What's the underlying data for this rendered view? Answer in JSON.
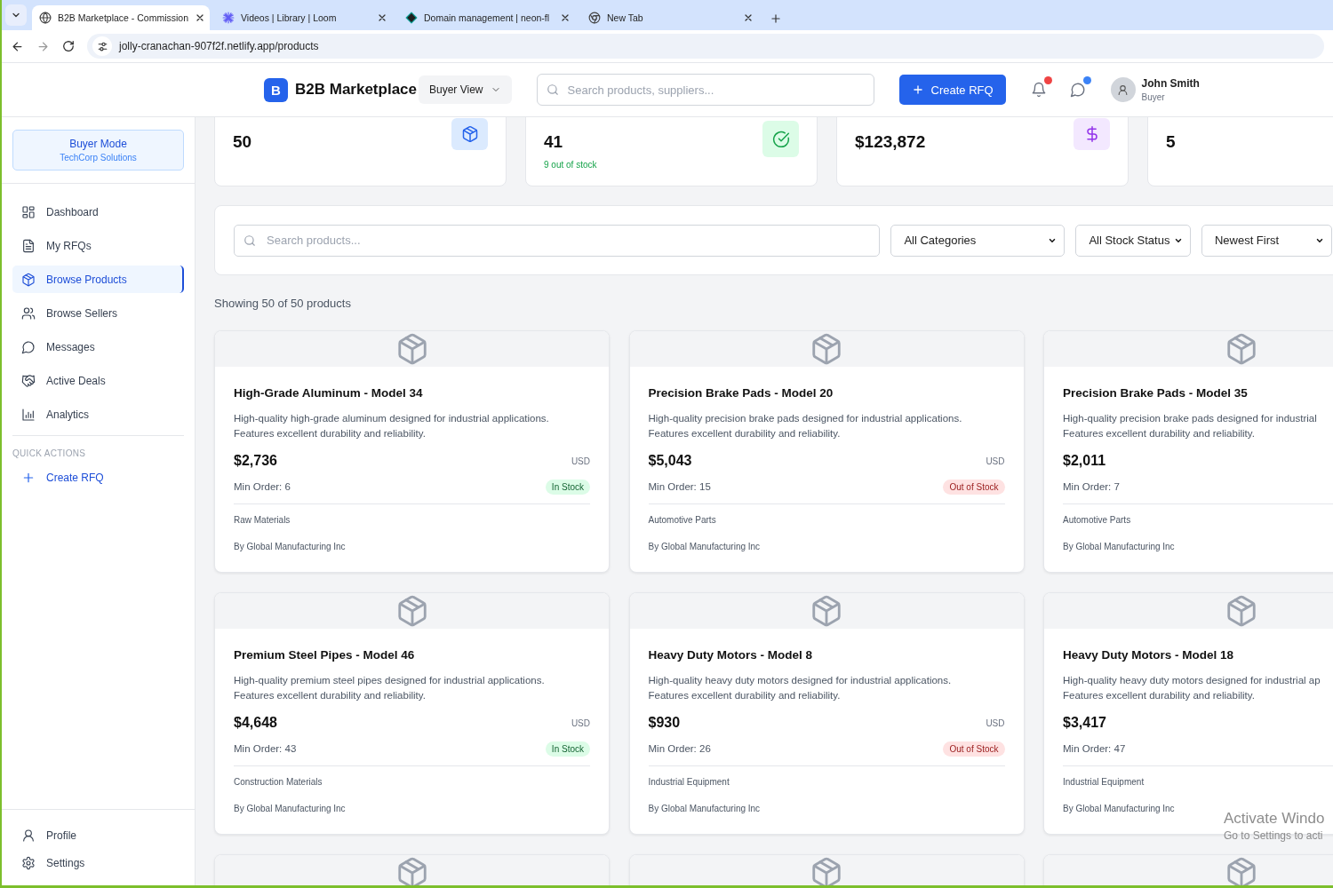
{
  "browser": {
    "tabs": [
      {
        "title": "B2B Marketplace - Commission",
        "kind": "globe",
        "selected": true
      },
      {
        "title": "Videos | Library | Loom",
        "kind": "burst",
        "selected": false
      },
      {
        "title": "Domain management | neon-fl",
        "kind": "diamond",
        "selected": false
      },
      {
        "title": "New Tab",
        "kind": "ring",
        "selected": false
      }
    ],
    "address": "jolly-cranachan-907f2f.netlify.app/products"
  },
  "header": {
    "logo_letter": "B",
    "brand": "B2B Marketplace",
    "view_select": "Buyer View",
    "search_placeholder": "Search products, suppliers...",
    "create_button": "Create RFQ",
    "notifications": [
      {
        "kind": "bell",
        "color": "#ef4444"
      },
      {
        "kind": "chat",
        "color": "#3b82f6"
      }
    ],
    "user": {
      "name": "John Smith",
      "role": "Buyer"
    }
  },
  "sidebar": {
    "mode_card": {
      "title": "Buyer Mode",
      "subtitle": "TechCorp Solutions"
    },
    "nav": [
      {
        "label": "Dashboard",
        "kind": "grid",
        "selected": false
      },
      {
        "label": "My RFQs",
        "kind": "file",
        "selected": false
      },
      {
        "label": "Browse Products",
        "kind": "box",
        "selected": true
      },
      {
        "label": "Browse Sellers",
        "kind": "users",
        "selected": false
      },
      {
        "label": "Messages",
        "kind": "chat",
        "selected": false
      },
      {
        "label": "Active Deals",
        "kind": "handshake",
        "selected": false
      },
      {
        "label": "Analytics",
        "kind": "chart",
        "selected": false
      }
    ],
    "quick_actions": {
      "heading": "QUICK ACTIONS",
      "items": [
        {
          "label": "Create RFQ",
          "kind": "plus"
        }
      ]
    },
    "footer_nav": [
      {
        "label": "Profile",
        "kind": "user"
      },
      {
        "label": "Settings",
        "kind": "gear"
      }
    ]
  },
  "stats": [
    {
      "value": "50",
      "kind": "box"
    },
    {
      "value": "41",
      "note": "9 out of stock",
      "kind": "check"
    },
    {
      "value": "$123,872",
      "kind": "dollar"
    },
    {
      "value": "5",
      "kind": "plain"
    }
  ],
  "filters": {
    "search_placeholder": "Search products...",
    "selects": [
      "All Categories",
      "All Stock Status",
      "Newest First"
    ]
  },
  "result_count": "Showing 50 of 50 products",
  "products": [
    {
      "kind": "full",
      "title": "High-Grade Aluminum - Model 34",
      "description": [
        "High-quality high-grade aluminum designed for industrial applications.",
        "Features excellent durability and reliability."
      ],
      "price": "$2,736",
      "currency": "USD",
      "min_order": "Min Order: 6",
      "stock": {
        "label": "In Stock",
        "in_stock": true
      },
      "category": "Raw Materials",
      "seller": "By Global Manufacturing Inc"
    },
    {
      "kind": "full",
      "title": "Precision Brake Pads - Model 20",
      "description": [
        "High-quality precision brake pads designed for industrial applications.",
        "Features excellent durability and reliability."
      ],
      "price": "$5,043",
      "currency": "USD",
      "min_order": "Min Order: 15",
      "stock": {
        "label": "Out of Stock",
        "in_stock": false
      },
      "category": "Automotive Parts",
      "seller": "By Global Manufacturing Inc"
    },
    {
      "kind": "full",
      "title": "Precision Brake Pads - Model 35",
      "description": [
        "High-quality precision brake pads designed for industrial",
        "Features excellent durability and reliability."
      ],
      "price": "$2,011",
      "min_order": "Min Order: 7",
      "category": "Automotive Parts",
      "seller": "By Global Manufacturing Inc"
    },
    {
      "kind": "full",
      "title": "Premium Steel Pipes - Model 46",
      "description": [
        "High-quality premium steel pipes designed for industrial applications.",
        "Features excellent durability and reliability."
      ],
      "price": "$4,648",
      "currency": "USD",
      "min_order": "Min Order: 43",
      "stock": {
        "label": "In Stock",
        "in_stock": true
      },
      "category": "Construction Materials",
      "seller": "By Global Manufacturing Inc"
    },
    {
      "kind": "full",
      "title": "Heavy Duty Motors - Model 8",
      "description": [
        "High-quality heavy duty motors designed for industrial applications.",
        "Features excellent durability and reliability."
      ],
      "price": "$930",
      "currency": "USD",
      "min_order": "Min Order: 26",
      "stock": {
        "label": "Out of Stock",
        "in_stock": false
      },
      "category": "Industrial Equipment",
      "seller": "By Global Manufacturing Inc"
    },
    {
      "kind": "full",
      "title": "Heavy Duty Motors - Model 18",
      "description": [
        "High-quality heavy duty motors designed for industrial ap",
        "Features excellent durability and reliability."
      ],
      "price": "$3,417",
      "min_order": "Min Order: 47",
      "category": "Industrial Equipment",
      "seller": "By Global Manufacturing Inc"
    },
    {
      "kind": "image_only"
    },
    {
      "kind": "image_only"
    },
    {
      "kind": "image_only"
    }
  ],
  "os_notice": {
    "title": "Activate Windo",
    "subtitle": "Go to Settings to acti"
  }
}
